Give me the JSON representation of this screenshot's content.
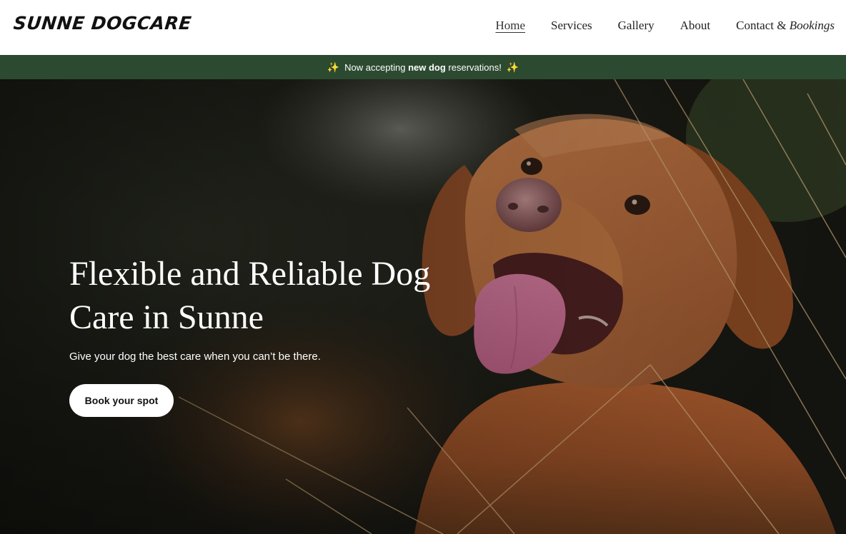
{
  "brand": {
    "logo_text": "SUNNE DOGCARE"
  },
  "nav": {
    "items": [
      {
        "label": "Home",
        "active": true
      },
      {
        "label": "Services",
        "active": false
      },
      {
        "label": "Gallery",
        "active": false
      },
      {
        "label": "About",
        "active": false
      }
    ],
    "contact_prefix": "Contact &",
    "contact_suffix": "Bookings"
  },
  "banner": {
    "icon": "sparkles-icon",
    "text_before": "Now accepting",
    "text_bold": "new dog",
    "text_after": "reservations!",
    "bg_color": "#2c4a30"
  },
  "hero": {
    "title": "Flexible and Reliable Dog Care in Sunne",
    "subtitle": "Give your dog the best care when you can’t be there.",
    "cta_label": "Book your spot",
    "image_alt": "dog-photo"
  }
}
